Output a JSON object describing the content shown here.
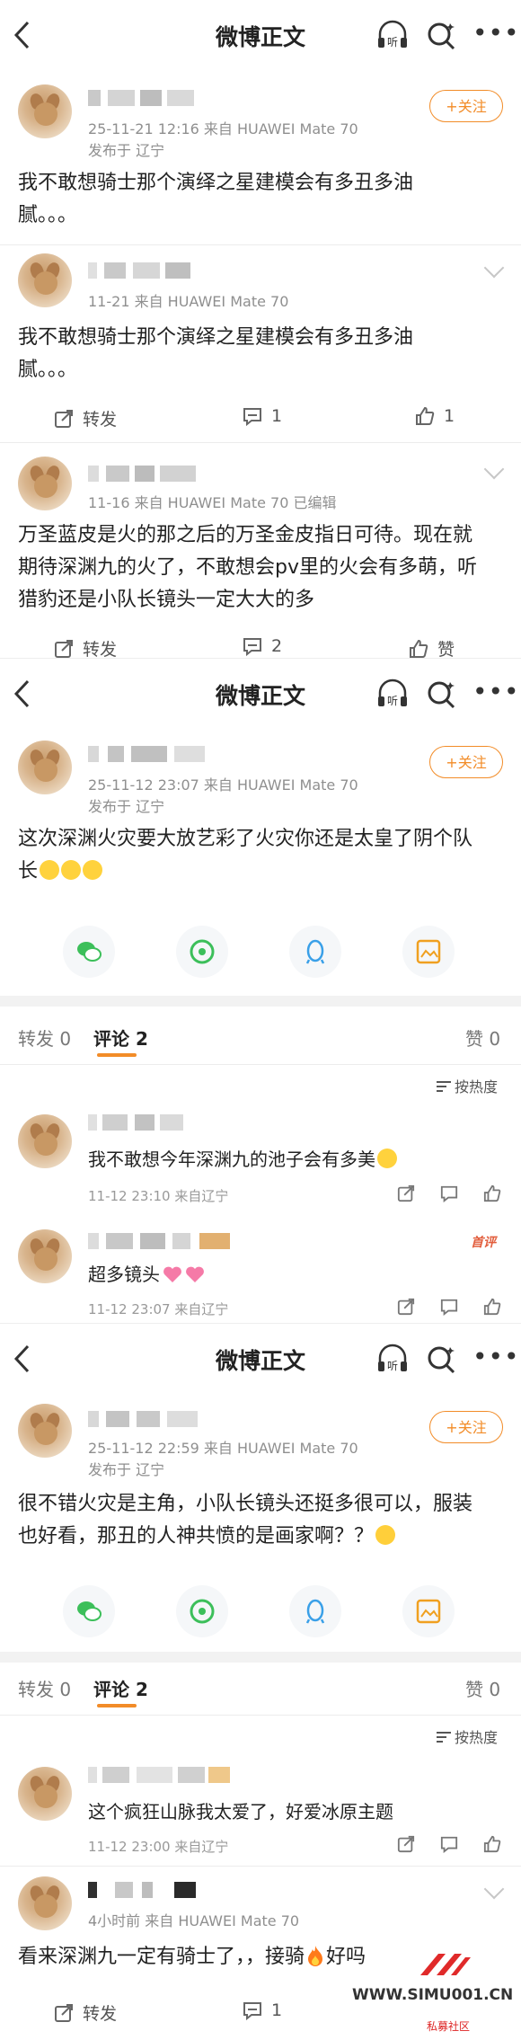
{
  "nav": {
    "title": "微博正文",
    "listen_label": "听"
  },
  "follow_label": "+关注",
  "post1": {
    "meta": "25-11-21 12:16  来自 HUAWEI Mate 70",
    "location": "发布于 辽宁",
    "text_line1": "我不敢想骑士那个演绎之星建模会有多丑多油",
    "text_line2": "腻。。。"
  },
  "repost1": {
    "meta": "11-21  来自 HUAWEI Mate 70",
    "text_line1": "我不敢想骑士那个演绎之星建模会有多丑多油",
    "text_line2": "腻。。。",
    "repost_label": "转发",
    "comment_count": "1",
    "like_count": "1"
  },
  "repost2": {
    "meta": "11-16  来自 HUAWEI Mate 70  已编辑",
    "text_line1": "万圣蓝皮是火的那之后的万圣金皮指日可待。现在就",
    "text_line2": "期待深渊九的火了，不敢想会pv里的火会有多萌，听",
    "text_line3": "猎豹还是小队长镜头一定大大的多",
    "repost_label": "转发",
    "comment_count": "2",
    "like_label": "赞"
  },
  "post2": {
    "meta": "25-11-12 23:07  来自 HUAWEI Mate 70",
    "location": "发布于 辽宁",
    "text_line1": "这次深渊火灾要大放艺彩了火灾你还是太皇了阴个队",
    "text_line2": "长"
  },
  "tabs1": {
    "repost": "转发 0",
    "comment": "评论 2",
    "like": "赞 0",
    "sort": "按热度"
  },
  "comment1": {
    "text": "我不敢想今年深渊九的池子会有多美",
    "meta": "11-12 23:10  来自辽宁"
  },
  "comment2": {
    "text": "超多镜头",
    "meta": "11-12 23:07  来自辽宁",
    "badge": "首评"
  },
  "post3": {
    "meta": "25-11-12 22:59  来自 HUAWEI Mate 70",
    "location": "发布于 辽宁",
    "text_line1": "很不错火灾是主角，小队长镜头还挺多很可以，服装",
    "text_line2": "也好看，那丑的人神共愤的是画家啊？？"
  },
  "tabs2": {
    "repost": "转发 0",
    "comment": "评论 2",
    "like": "赞 0",
    "sort": "按热度"
  },
  "comment3": {
    "text": "这个疯狂山脉我太爱了，好爱冰原主题",
    "meta": "11-12 23:00  来自辽宁"
  },
  "repost3": {
    "meta": "4小时前  来自 HUAWEI Mate 70",
    "text": "看来深渊九一定有骑士了，，接骑",
    "text_tail": "好吗",
    "repost_label": "转发",
    "comment_count": "1"
  },
  "watermark": {
    "site": "WWW.SIMU001.CN",
    "sub": "私募社区"
  },
  "colors": {
    "accent": "#f28c28",
    "meta_gray": "#8f8f8f",
    "divider": "#ececec"
  }
}
